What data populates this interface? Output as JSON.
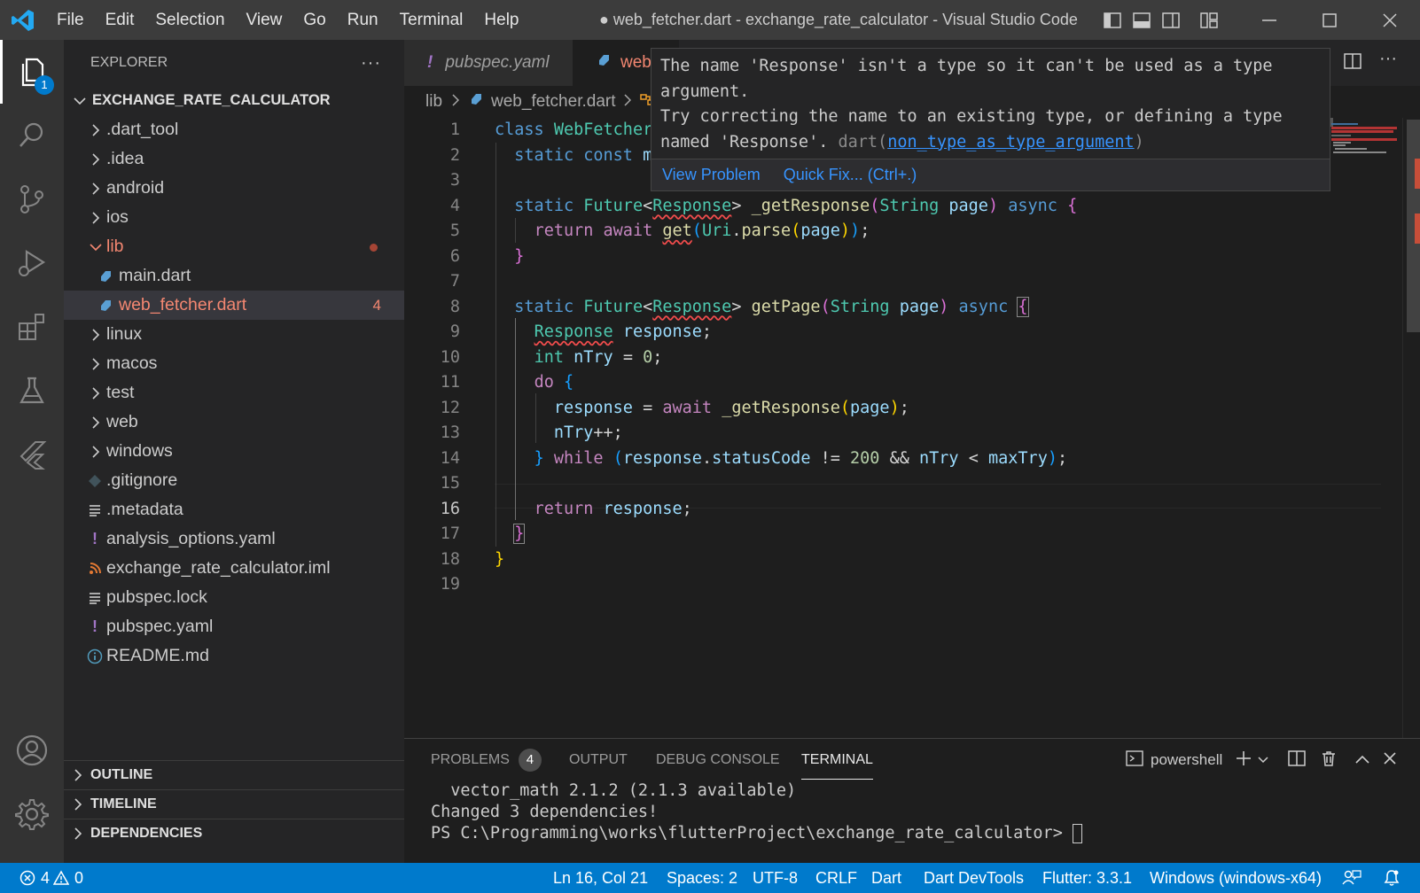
{
  "titlebar": {
    "menu": [
      "File",
      "Edit",
      "Selection",
      "View",
      "Go",
      "Run",
      "Terminal",
      "Help"
    ],
    "title": "● web_fetcher.dart - exchange_rate_calculator - Visual Studio Code"
  },
  "activity": {
    "explorer_badge": "1"
  },
  "explorer": {
    "header": "EXPLORER",
    "root": "EXCHANGE_RATE_CALCULATOR",
    "items": [
      {
        "label": ".dart_tool"
      },
      {
        "label": ".idea"
      },
      {
        "label": "android"
      },
      {
        "label": "ios"
      },
      {
        "label": "lib"
      },
      {
        "label": "main.dart"
      },
      {
        "label": "web_fetcher.dart",
        "problems": "4"
      },
      {
        "label": "linux"
      },
      {
        "label": "macos"
      },
      {
        "label": "test"
      },
      {
        "label": "web"
      },
      {
        "label": "windows"
      },
      {
        "label": ".gitignore"
      },
      {
        "label": ".metadata"
      },
      {
        "label": "analysis_options.yaml"
      },
      {
        "label": "exchange_rate_calculator.iml"
      },
      {
        "label": "pubspec.lock"
      },
      {
        "label": "pubspec.yaml"
      },
      {
        "label": "README.md"
      }
    ],
    "sections": [
      "OUTLINE",
      "TIMELINE",
      "DEPENDENCIES"
    ]
  },
  "tabs": [
    {
      "label": "pubspec.yaml"
    },
    {
      "label": "web"
    }
  ],
  "breadcrumb": {
    "folder": "lib",
    "file": "web_fetcher.dart"
  },
  "editor": {
    "line_numbers": [
      "1",
      "2",
      "3",
      "4",
      "5",
      "6",
      "7",
      "8",
      "9",
      "10",
      "11",
      "12",
      "13",
      "14",
      "15",
      "16",
      "17",
      "18",
      "19"
    ],
    "current_line": "16"
  },
  "hover": {
    "message": "The name 'Response' isn't a type so it can't be used as a type argument.\nTry correcting the name to an existing type, or defining a type named 'Response'. ",
    "source": "dart(",
    "code": "non_type_as_type_argument",
    "source_end": ")",
    "view_problem": "View Problem",
    "quick_fix": "Quick Fix... (Ctrl+.)"
  },
  "panel": {
    "tabs": [
      "PROBLEMS",
      "OUTPUT",
      "DEBUG CONSOLE",
      "TERMINAL"
    ],
    "problems_count": "4",
    "shell": "powershell",
    "terminal_lines": [
      "  vector_math 2.1.2 (2.1.3 available)",
      "Changed 3 dependencies!",
      "PS C:\\Programming\\works\\flutterProject\\exchange_rate_calculator> "
    ]
  },
  "status": {
    "errors": "4",
    "warnings": "0",
    "position": "Ln 16, Col 21",
    "spaces": "Spaces: 2",
    "encoding": "UTF-8",
    "eol": "CRLF",
    "language": "Dart",
    "devtools": "Dart DevTools",
    "flutter": "Flutter: 3.3.1",
    "device": "Windows (windows-x64)"
  },
  "colors": {
    "accent": "#007acc",
    "error": "#f14c4c",
    "titlebar": "#3c3c3c"
  }
}
